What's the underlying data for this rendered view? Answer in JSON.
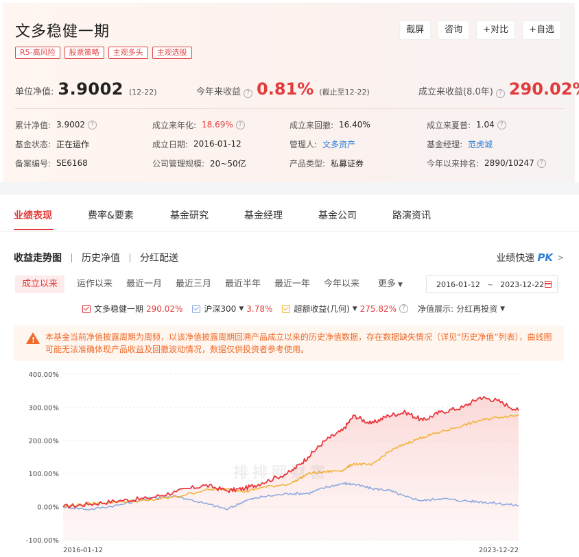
{
  "header": {
    "fund_name": "文多稳健一期",
    "buttons": [
      "截屏",
      "咨询",
      "+对比",
      "+自选"
    ],
    "tags": [
      "R5-高风险",
      "股票策略",
      "主观多头",
      "主观选股"
    ],
    "nav_label": "单位净值:",
    "nav_value": "3.9002",
    "nav_date": "(12-22)",
    "ytd_label": "今年来收益",
    "ytd_value": "0.81%",
    "ytd_note": "(截止至12-22)",
    "since_label": "成立来收益(8.0年)",
    "since_value": "290.02%"
  },
  "info": [
    [
      {
        "k": "累计净值:",
        "v": "3.9002",
        "q": true
      },
      {
        "k": "成立来年化:",
        "v": "18.69%",
        "q": true,
        "style": "red"
      },
      {
        "k": "成立来回撤:",
        "v": "16.40%",
        "q": false
      },
      {
        "k": "成立来夏普:",
        "v": "1.04",
        "q": true
      }
    ],
    [
      {
        "k": "基金状态:",
        "v": "正在运作",
        "q": false
      },
      {
        "k": "成立日期:",
        "v": "2016-01-12",
        "q": false
      },
      {
        "k": "管理人:",
        "v": "文多资产",
        "q": false,
        "style": "link"
      },
      {
        "k": "基金经理:",
        "v": "范虎城",
        "q": false,
        "style": "link"
      }
    ],
    [
      {
        "k": "备案编号:",
        "v": "SE6168",
        "q": false
      },
      {
        "k": "公司管理规模:",
        "v": "20~50亿",
        "q": false
      },
      {
        "k": "产品类型:",
        "v": "私募证券",
        "q": false
      },
      {
        "k": "今年以来排名:",
        "v": "2890/10247",
        "q": true
      }
    ]
  ],
  "tabs": [
    "业绩表现",
    "费率&要素",
    "基金研究",
    "基金经理",
    "基金公司",
    "路演资讯"
  ],
  "subtabs": [
    "收益走势图",
    "历史净值",
    "分红配送"
  ],
  "quick": {
    "label": "业绩快速",
    "pk": "PK"
  },
  "ranges": [
    "成立以来",
    "运作以来",
    "最近一月",
    "最近三月",
    "最近半年",
    "最近一年",
    "今年以来",
    "更多"
  ],
  "date_range": {
    "start": "2016-01-12",
    "tilde": "~",
    "end": "2023-12-22"
  },
  "legend": [
    {
      "name": "文多稳健一期",
      "value": "290.02%",
      "color": "#e8363d"
    },
    {
      "name": "沪深300",
      "value": "3.78%",
      "color": "#8aa6e0"
    },
    {
      "name": "超额收益(几何)",
      "value": "275.82%",
      "color": "#f2b134"
    }
  ],
  "display_mode": {
    "label": "净值展示:",
    "value": "分红再投资"
  },
  "warning": "本基金当前净值披露周期为周频，以该净值披露周期回溯产品成立以来的历史净值数据，存在数据缺失情况（详见“历史净值”列表），曲线图可能无法准确体现产品收益及回撤波动情况，数据仅供投资者参考使用。",
  "watermark": "排排网财富",
  "chart_data": {
    "type": "line",
    "ylim": [
      -100,
      400
    ],
    "y_ticks": [
      "400.00%",
      "300.00%",
      "200.00%",
      "100.00%",
      "0.00%",
      "-100.00%"
    ],
    "y_tick_values": [
      400,
      300,
      200,
      100,
      0,
      -100
    ],
    "x_labels": [
      "2016-01-12",
      "2023-12-22"
    ],
    "x": [
      2016.03,
      2016.5,
      2017.0,
      2017.5,
      2018.0,
      2018.5,
      2018.9,
      2019.2,
      2019.5,
      2020.0,
      2020.3,
      2020.6,
      2020.9,
      2021.1,
      2021.4,
      2021.7,
      2022.0,
      2022.3,
      2022.6,
      2023.0,
      2023.3,
      2023.6,
      2023.97
    ],
    "series": [
      {
        "name": "文多稳健一期",
        "color": "#e8363d",
        "values": [
          0,
          8,
          18,
          25,
          45,
          65,
          48,
          55,
          72,
          105,
          150,
          200,
          230,
          275,
          250,
          275,
          285,
          260,
          285,
          300,
          330,
          320,
          290
        ]
      },
      {
        "name": "沪深300",
        "color": "#8aa6e0",
        "values": [
          0,
          -8,
          5,
          25,
          32,
          10,
          -8,
          18,
          30,
          40,
          40,
          58,
          70,
          68,
          55,
          50,
          30,
          18,
          25,
          18,
          15,
          10,
          4
        ]
      },
      {
        "name": "超额收益(几何)",
        "color": "#f2b134",
        "values": [
          0,
          10,
          15,
          18,
          30,
          50,
          55,
          45,
          58,
          70,
          100,
          105,
          110,
          130,
          125,
          165,
          190,
          210,
          225,
          245,
          260,
          270,
          276
        ]
      }
    ]
  }
}
